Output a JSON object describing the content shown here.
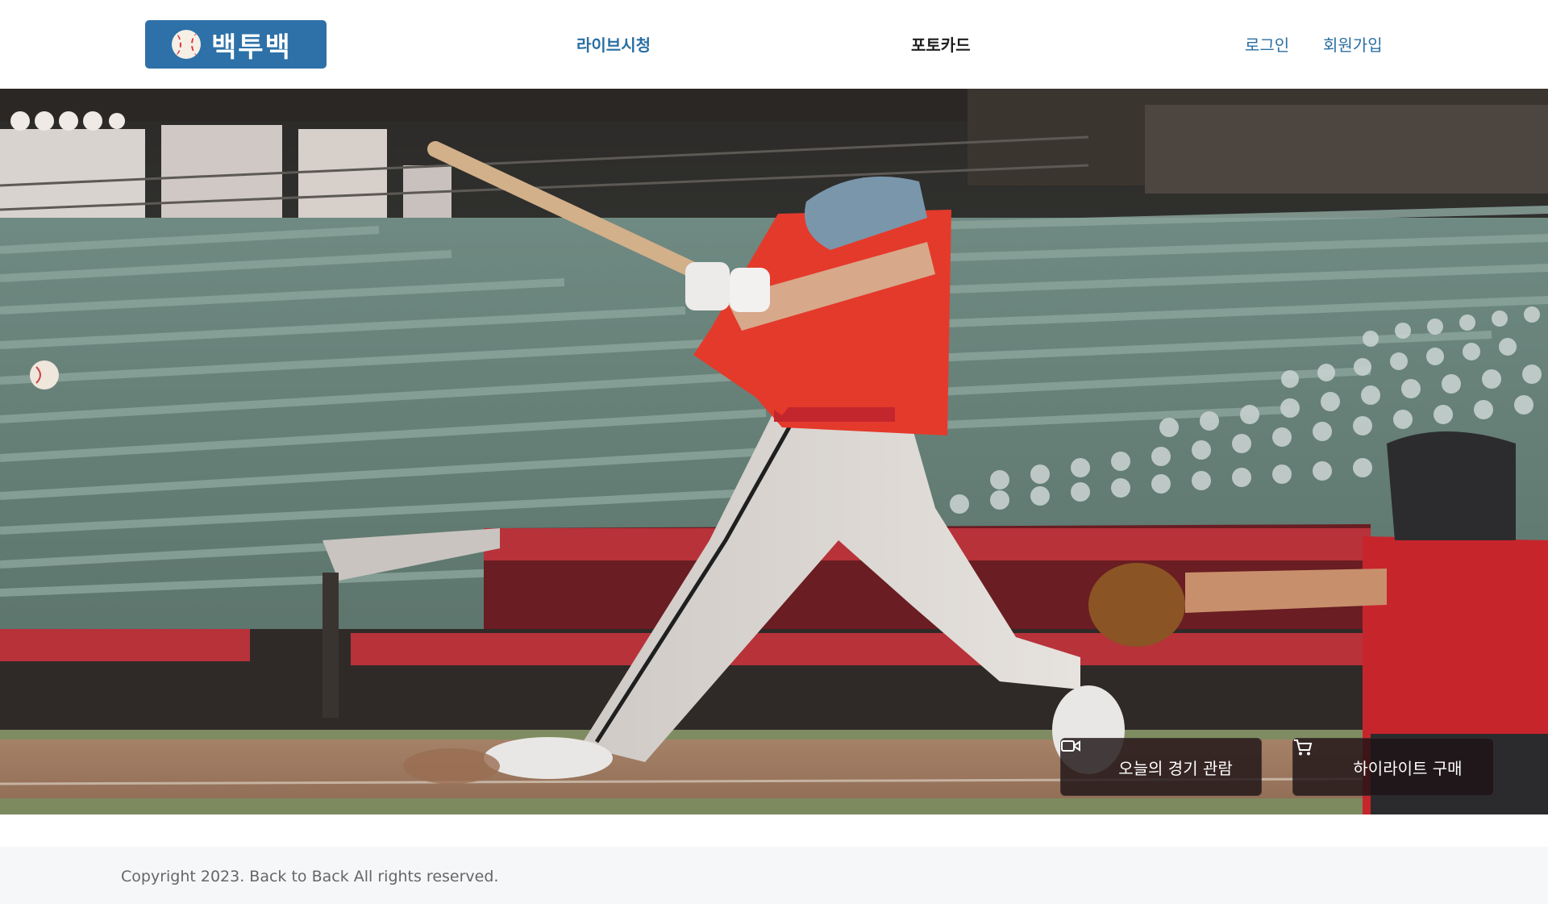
{
  "header": {
    "logo_text": "백투백",
    "logo_icon": "baseball-icon",
    "nav": {
      "live": "라이브시청",
      "photocard": "포토카드"
    },
    "auth": {
      "login": "로그인",
      "signup": "회원가입"
    }
  },
  "hero": {
    "image_alt": "",
    "buttons": {
      "watch": {
        "label": "오늘의 경기 관람",
        "icon": "video-camera-icon"
      },
      "buy": {
        "label": "하이라이트 구매",
        "icon": "shopping-cart-icon"
      }
    }
  },
  "footer": {
    "copyright": "Copyright 2023. Back to Back All rights reserved."
  },
  "colors": {
    "brand": "#2d71a8",
    "nav_link": "#2a6fa3",
    "nav_active": "#1e1e1e",
    "footer_bg": "#f6f7f9"
  }
}
